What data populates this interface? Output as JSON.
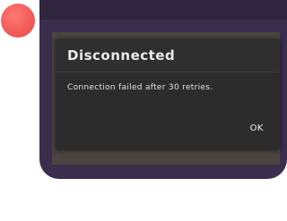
{
  "dialog": {
    "title": "Disconnected",
    "message": "Connection failed after 30 retries.",
    "ok_label": "OK"
  },
  "colors": {
    "record_dot": "#f25a57",
    "device_frame": "#3a2e4c",
    "dialog_bg": "#2c2c2c"
  }
}
